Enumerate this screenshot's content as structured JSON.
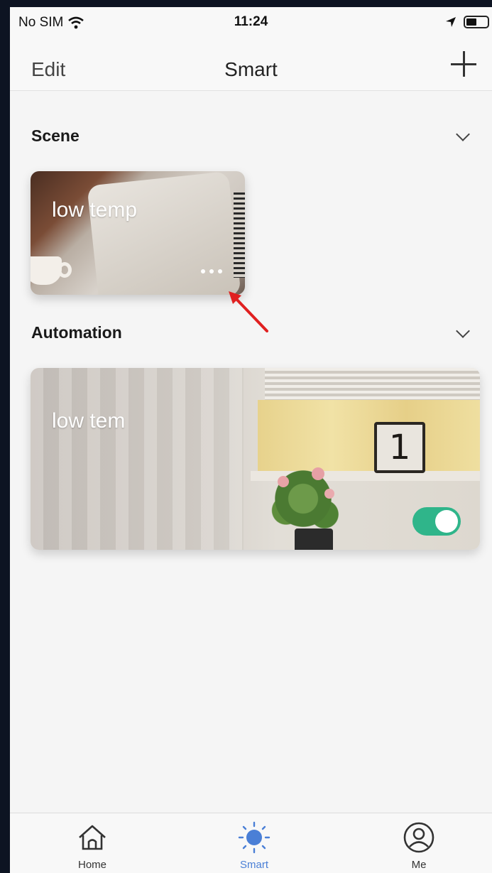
{
  "status_bar": {
    "carrier": "No SIM",
    "time": "11:24"
  },
  "nav": {
    "edit_label": "Edit",
    "title": "Smart",
    "add_icon": "plus-icon"
  },
  "scene_section": {
    "title": "Scene",
    "collapse_icon": "chevron-down-icon",
    "cards": [
      {
        "title": "low temp",
        "more_icon": "more-dots-icon"
      }
    ]
  },
  "automation_section": {
    "title": "Automation",
    "collapse_icon": "chevron-down-icon",
    "cards": [
      {
        "title": "low tem",
        "enabled": true,
        "clock_digit": "1"
      }
    ]
  },
  "tabbar": {
    "items": [
      {
        "label": "Home",
        "icon": "home-icon",
        "active": false
      },
      {
        "label": "Smart",
        "icon": "sun-icon",
        "active": true
      },
      {
        "label": "Me",
        "icon": "user-icon",
        "active": false
      }
    ]
  },
  "colors": {
    "accent_blue": "#4a7fd6",
    "toggle_on": "#2fb58a",
    "annotation_red": "#e02020"
  }
}
